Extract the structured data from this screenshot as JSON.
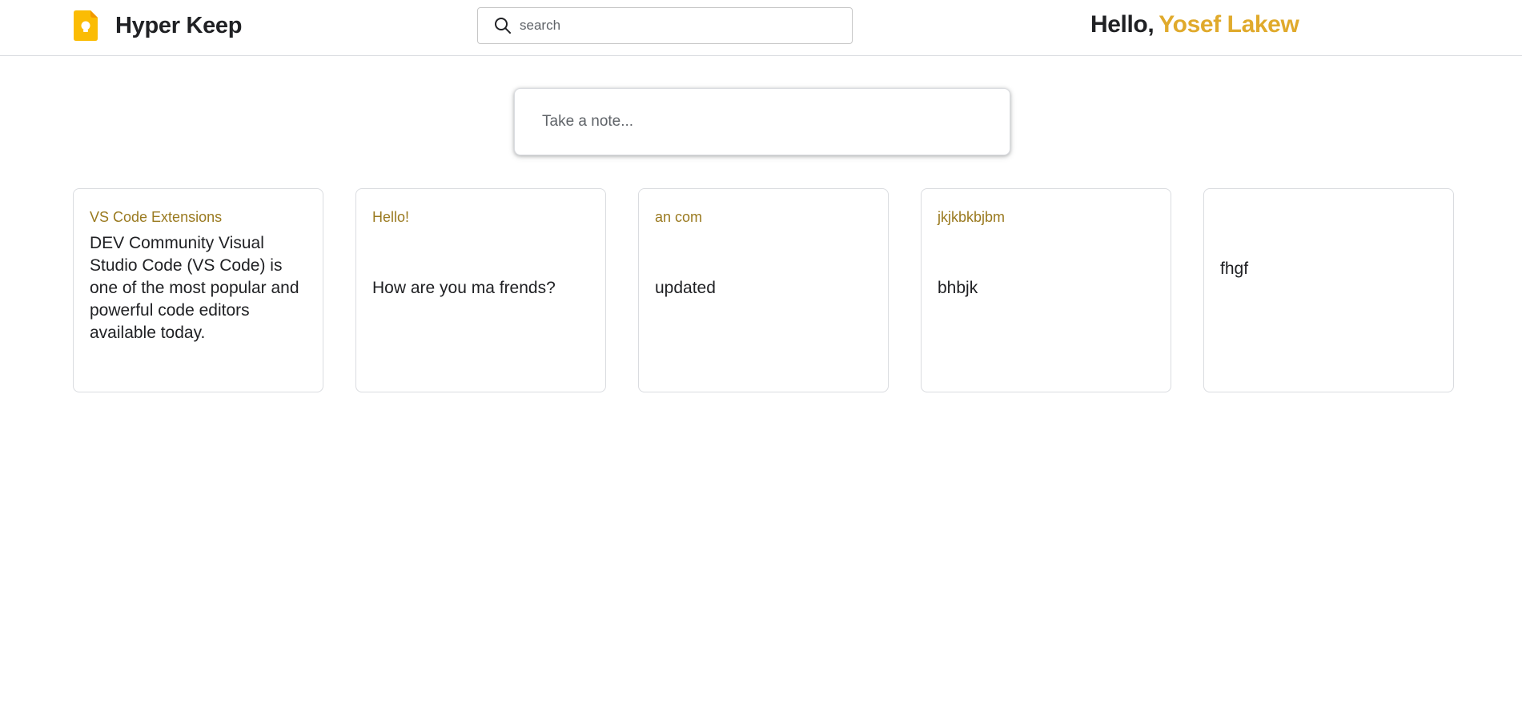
{
  "header": {
    "brand_name": "Hyper Keep",
    "logo_icon": "keep-bulb-icon",
    "search_placeholder": "search",
    "search_value": "",
    "greeting_hello": "Hello,",
    "greeting_user": "Yosef Lakew"
  },
  "composer": {
    "placeholder": "Take a note..."
  },
  "notes": [
    {
      "title": "VS Code Extensions",
      "body": "DEV Community Visual Studio Code (VS Code) is one of the most popular and powerful code editors available today."
    },
    {
      "title": "Hello!",
      "body": "How are you ma frends?"
    },
    {
      "title": "an com",
      "body": "updated"
    },
    {
      "title": "jkjkbkbjbm",
      "body": "bhbjk"
    },
    {
      "title": "",
      "body": "fhgf"
    }
  ],
  "colors": {
    "accent": "#e0aa2c",
    "note_title": "#9a7a20",
    "logo": "#fbbc04",
    "border": "#dadce0"
  }
}
